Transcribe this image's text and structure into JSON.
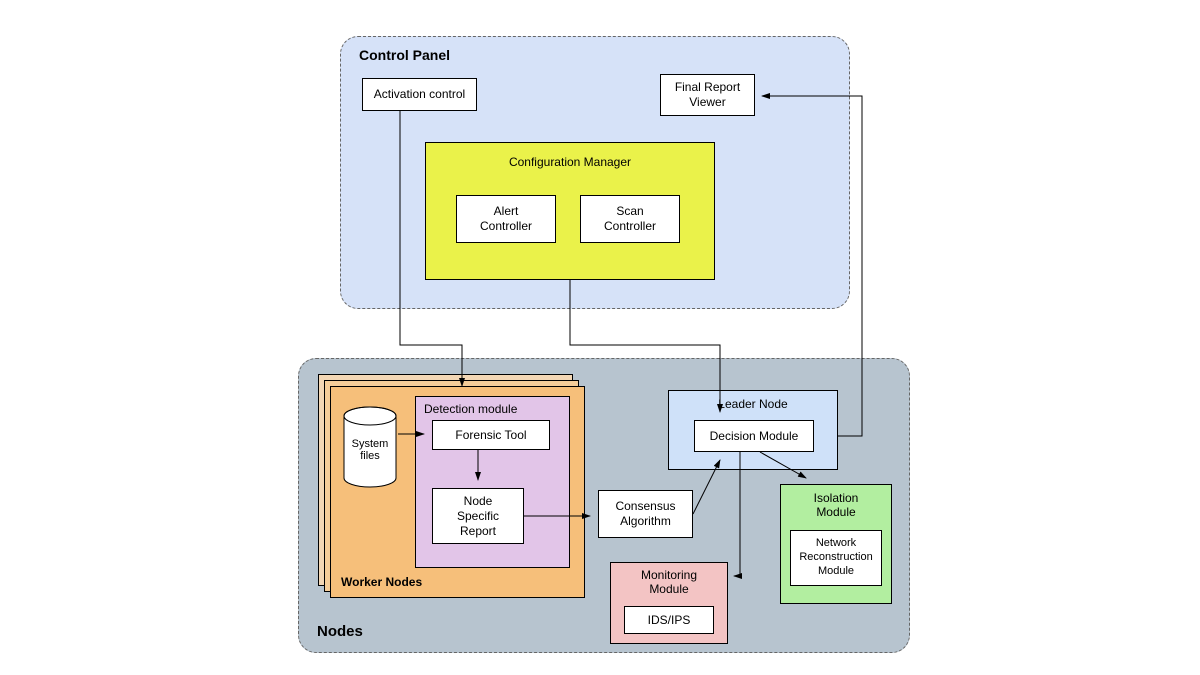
{
  "diagram": {
    "control_panel": {
      "title": "Control Panel",
      "activation_control": "Activation control",
      "final_report_viewer": "Final Report\nViewer",
      "config_manager": {
        "title": "Configuration Manager",
        "alert_controller": "Alert\nController",
        "scan_controller": "Scan\nController"
      }
    },
    "nodes": {
      "title": "Nodes",
      "worker_nodes": {
        "title": "Worker Nodes",
        "system_files": "System\nfiles",
        "detection_module": {
          "title": "Detection module",
          "forensic_tool": "Forensic Tool",
          "node_specific_report": "Node\nSpecific\nReport"
        }
      },
      "consensus_algorithm": "Consensus\nAlgorithm",
      "leader_node": {
        "title": "Leader Node",
        "decision_module": "Decision Module"
      },
      "isolation_module": {
        "title": "Isolation\nModule",
        "network_reconstruction": "Network\nReconstruction\nModule"
      },
      "monitoring_module": {
        "title": "Monitoring\nModule",
        "ids_ips": "IDS/IPS"
      }
    }
  },
  "colors": {
    "control_panel_bg": "#d6e2f8",
    "nodes_bg": "#b7c4cf",
    "config_manager_bg": "#eaf24a",
    "worker_nodes_bg": "#f6bf7a",
    "detection_module_bg": "#e2c5e8",
    "leader_node_bg": "#cfe1f9",
    "isolation_bg": "#b2eea0",
    "monitoring_bg": "#f3c4c4"
  }
}
